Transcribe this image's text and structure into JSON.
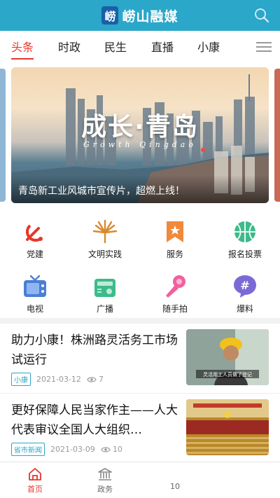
{
  "header": {
    "logo_char": "崂",
    "app_title": "崂山融媒"
  },
  "tabs": [
    {
      "label": "头条",
      "active": true
    },
    {
      "label": "时政",
      "active": false
    },
    {
      "label": "民生",
      "active": false
    },
    {
      "label": "直播",
      "active": false
    },
    {
      "label": "小康",
      "active": false
    }
  ],
  "banner": {
    "title": "成长·青岛",
    "subtitle": "Growth Qingdao",
    "caption": "青岛新工业风城市宣传片，超燃上线！"
  },
  "services": [
    {
      "label": "党建",
      "icon": "party-emblem-icon"
    },
    {
      "label": "文明实践",
      "icon": "civilization-practice-icon"
    },
    {
      "label": "服务",
      "icon": "service-bookmark-icon"
    },
    {
      "label": "报名投票",
      "icon": "vote-ball-icon"
    },
    {
      "label": "电视",
      "icon": "tv-icon"
    },
    {
      "label": "广播",
      "icon": "radio-icon"
    },
    {
      "label": "随手拍",
      "icon": "microphone-icon"
    },
    {
      "label": "爆料",
      "icon": "hashtag-chat-icon"
    }
  ],
  "news": [
    {
      "title": "助力小康！株洲路灵活务工市场试运行",
      "tag": "小康",
      "date": "2021-03-12",
      "views": "7",
      "thumb_caption": "灵活用工人员做了登记"
    },
    {
      "title": "更好保障人民当家作主——人大代表审议全国人大组织…",
      "tag": "省市新闻",
      "date": "2021-03-09",
      "views": "10"
    }
  ],
  "bottom_nav": [
    {
      "label": "首页",
      "icon": "home-icon",
      "active": true
    },
    {
      "label": "政务",
      "icon": "government-building-icon",
      "active": false
    },
    {
      "label": "10",
      "icon": "",
      "active": false
    }
  ],
  "colors": {
    "brand": "#2aa7c9",
    "accent": "#e8362a"
  }
}
